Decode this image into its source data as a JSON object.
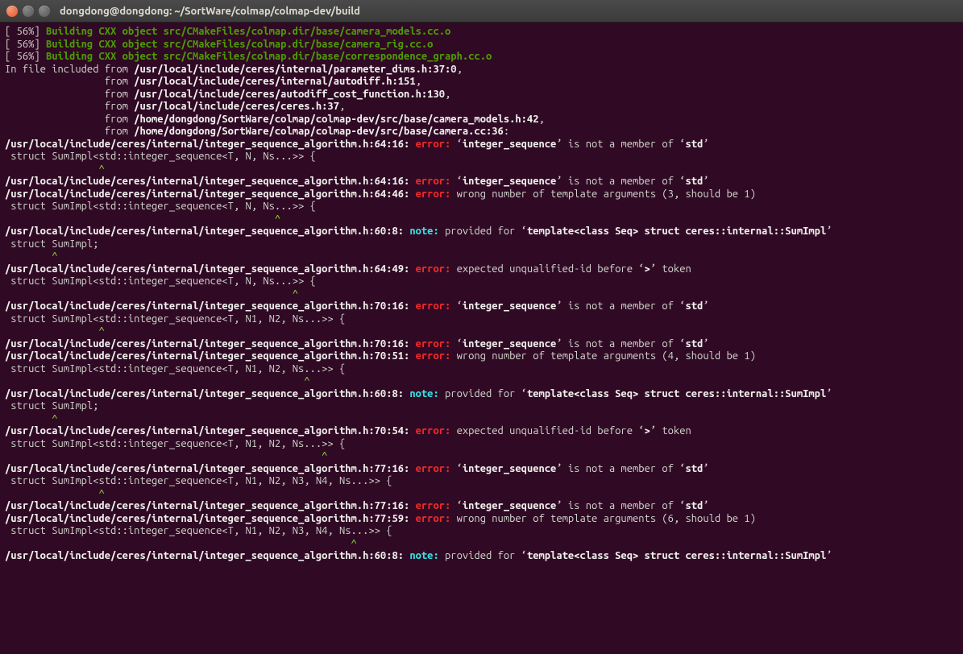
{
  "window": {
    "title": "dongdong@dongdong: ~/SortWare/colmap/colmap-dev/build"
  },
  "lines": [
    [
      {
        "cls": "w",
        "t": "[ 56%] "
      },
      {
        "cls": "gb",
        "t": "Building CXX object src/CMakeFiles/colmap.dir/base/camera_models.cc.o"
      }
    ],
    [
      {
        "cls": "w",
        "t": "[ 56%] "
      },
      {
        "cls": "gb",
        "t": "Building CXX object src/CMakeFiles/colmap.dir/base/camera_rig.cc.o"
      }
    ],
    [
      {
        "cls": "w",
        "t": "[ 56%] "
      },
      {
        "cls": "gb",
        "t": "Building CXX object src/CMakeFiles/colmap.dir/base/correspondence_graph.cc.o"
      }
    ],
    [
      {
        "cls": "w",
        "t": "In file included from "
      },
      {
        "cls": "b",
        "t": "/usr/local/include/ceres/internal/parameter_dims.h:37:0"
      },
      {
        "cls": "w",
        "t": ","
      }
    ],
    [
      {
        "cls": "w",
        "t": "                 from "
      },
      {
        "cls": "b",
        "t": "/usr/local/include/ceres/internal/autodiff.h:151"
      },
      {
        "cls": "w",
        "t": ","
      }
    ],
    [
      {
        "cls": "w",
        "t": "                 from "
      },
      {
        "cls": "b",
        "t": "/usr/local/include/ceres/autodiff_cost_function.h:130"
      },
      {
        "cls": "w",
        "t": ","
      }
    ],
    [
      {
        "cls": "w",
        "t": "                 from "
      },
      {
        "cls": "b",
        "t": "/usr/local/include/ceres/ceres.h:37"
      },
      {
        "cls": "w",
        "t": ","
      }
    ],
    [
      {
        "cls": "w",
        "t": "                 from "
      },
      {
        "cls": "b",
        "t": "/home/dongdong/SortWare/colmap/colmap-dev/src/base/camera_models.h:42"
      },
      {
        "cls": "w",
        "t": ","
      }
    ],
    [
      {
        "cls": "w",
        "t": "                 from "
      },
      {
        "cls": "b",
        "t": "/home/dongdong/SortWare/colmap/colmap-dev/src/base/camera.cc:36"
      },
      {
        "cls": "w",
        "t": ":"
      }
    ],
    [
      {
        "cls": "b",
        "t": "/usr/local/include/ceres/internal/integer_sequence_algorithm.h:64:16:"
      },
      {
        "cls": "w",
        "t": " "
      },
      {
        "cls": "r",
        "t": "error:"
      },
      {
        "cls": "w",
        "t": " ‘"
      },
      {
        "cls": "b",
        "t": "integer_sequence"
      },
      {
        "cls": "w",
        "t": "’ is not a member of ‘"
      },
      {
        "cls": "b",
        "t": "std"
      },
      {
        "cls": "w",
        "t": "’"
      }
    ],
    [
      {
        "cls": "w",
        "t": " struct SumImpl<std::integer_sequence<T, N, Ns...>> {"
      }
    ],
    [
      {
        "cls": "g",
        "t": "                ^"
      }
    ],
    [
      {
        "cls": "b",
        "t": "/usr/local/include/ceres/internal/integer_sequence_algorithm.h:64:16:"
      },
      {
        "cls": "w",
        "t": " "
      },
      {
        "cls": "r",
        "t": "error:"
      },
      {
        "cls": "w",
        "t": " ‘"
      },
      {
        "cls": "b",
        "t": "integer_sequence"
      },
      {
        "cls": "w",
        "t": "’ is not a member of ‘"
      },
      {
        "cls": "b",
        "t": "std"
      },
      {
        "cls": "w",
        "t": "’"
      }
    ],
    [
      {
        "cls": "b",
        "t": "/usr/local/include/ceres/internal/integer_sequence_algorithm.h:64:46:"
      },
      {
        "cls": "w",
        "t": " "
      },
      {
        "cls": "r",
        "t": "error:"
      },
      {
        "cls": "w",
        "t": " wrong number of template arguments (3, should be 1)"
      }
    ],
    [
      {
        "cls": "w",
        "t": " struct SumImpl<std::integer_sequence<T, N, Ns...>> {"
      }
    ],
    [
      {
        "cls": "g",
        "t": "                                              ^"
      }
    ],
    [
      {
        "cls": "b",
        "t": "/usr/local/include/ceres/internal/integer_sequence_algorithm.h:60:8:"
      },
      {
        "cls": "w",
        "t": " "
      },
      {
        "cls": "cy",
        "t": "note:"
      },
      {
        "cls": "w",
        "t": " provided for ‘"
      },
      {
        "cls": "b",
        "t": "template<class Seq> struct ceres::internal::SumImpl"
      },
      {
        "cls": "w",
        "t": "’"
      }
    ],
    [
      {
        "cls": "w",
        "t": " struct SumImpl;"
      }
    ],
    [
      {
        "cls": "g",
        "t": "        ^"
      }
    ],
    [
      {
        "cls": "b",
        "t": "/usr/local/include/ceres/internal/integer_sequence_algorithm.h:64:49:"
      },
      {
        "cls": "w",
        "t": " "
      },
      {
        "cls": "r",
        "t": "error:"
      },
      {
        "cls": "w",
        "t": " expected unqualified-id before ‘"
      },
      {
        "cls": "b",
        "t": ">"
      },
      {
        "cls": "w",
        "t": "’ token"
      }
    ],
    [
      {
        "cls": "w",
        "t": " struct SumImpl<std::integer_sequence<T, N, Ns...>> {"
      }
    ],
    [
      {
        "cls": "g",
        "t": "                                                 ^"
      }
    ],
    [
      {
        "cls": "b",
        "t": "/usr/local/include/ceres/internal/integer_sequence_algorithm.h:70:16:"
      },
      {
        "cls": "w",
        "t": " "
      },
      {
        "cls": "r",
        "t": "error:"
      },
      {
        "cls": "w",
        "t": " ‘"
      },
      {
        "cls": "b",
        "t": "integer_sequence"
      },
      {
        "cls": "w",
        "t": "’ is not a member of ‘"
      },
      {
        "cls": "b",
        "t": "std"
      },
      {
        "cls": "w",
        "t": "’"
      }
    ],
    [
      {
        "cls": "w",
        "t": " struct SumImpl<std::integer_sequence<T, N1, N2, Ns...>> {"
      }
    ],
    [
      {
        "cls": "g",
        "t": "                ^"
      }
    ],
    [
      {
        "cls": "b",
        "t": "/usr/local/include/ceres/internal/integer_sequence_algorithm.h:70:16:"
      },
      {
        "cls": "w",
        "t": " "
      },
      {
        "cls": "r",
        "t": "error:"
      },
      {
        "cls": "w",
        "t": " ‘"
      },
      {
        "cls": "b",
        "t": "integer_sequence"
      },
      {
        "cls": "w",
        "t": "’ is not a member of ‘"
      },
      {
        "cls": "b",
        "t": "std"
      },
      {
        "cls": "w",
        "t": "’"
      }
    ],
    [
      {
        "cls": "b",
        "t": "/usr/local/include/ceres/internal/integer_sequence_algorithm.h:70:51:"
      },
      {
        "cls": "w",
        "t": " "
      },
      {
        "cls": "r",
        "t": "error:"
      },
      {
        "cls": "w",
        "t": " wrong number of template arguments (4, should be 1)"
      }
    ],
    [
      {
        "cls": "w",
        "t": " struct SumImpl<std::integer_sequence<T, N1, N2, Ns...>> {"
      }
    ],
    [
      {
        "cls": "g",
        "t": "                                                   ^"
      }
    ],
    [
      {
        "cls": "b",
        "t": "/usr/local/include/ceres/internal/integer_sequence_algorithm.h:60:8:"
      },
      {
        "cls": "w",
        "t": " "
      },
      {
        "cls": "cy",
        "t": "note:"
      },
      {
        "cls": "w",
        "t": " provided for ‘"
      },
      {
        "cls": "b",
        "t": "template<class Seq> struct ceres::internal::SumImpl"
      },
      {
        "cls": "w",
        "t": "’"
      }
    ],
    [
      {
        "cls": "w",
        "t": " struct SumImpl;"
      }
    ],
    [
      {
        "cls": "g",
        "t": "        ^"
      }
    ],
    [
      {
        "cls": "b",
        "t": "/usr/local/include/ceres/internal/integer_sequence_algorithm.h:70:54:"
      },
      {
        "cls": "w",
        "t": " "
      },
      {
        "cls": "r",
        "t": "error:"
      },
      {
        "cls": "w",
        "t": " expected unqualified-id before ‘"
      },
      {
        "cls": "b",
        "t": ">"
      },
      {
        "cls": "w",
        "t": "’ token"
      }
    ],
    [
      {
        "cls": "w",
        "t": " struct SumImpl<std::integer_sequence<T, N1, N2, Ns...>> {"
      }
    ],
    [
      {
        "cls": "g",
        "t": "                                                      ^"
      }
    ],
    [
      {
        "cls": "b",
        "t": "/usr/local/include/ceres/internal/integer_sequence_algorithm.h:77:16:"
      },
      {
        "cls": "w",
        "t": " "
      },
      {
        "cls": "r",
        "t": "error:"
      },
      {
        "cls": "w",
        "t": " ‘"
      },
      {
        "cls": "b",
        "t": "integer_sequence"
      },
      {
        "cls": "w",
        "t": "’ is not a member of ‘"
      },
      {
        "cls": "b",
        "t": "std"
      },
      {
        "cls": "w",
        "t": "’"
      }
    ],
    [
      {
        "cls": "w",
        "t": " struct SumImpl<std::integer_sequence<T, N1, N2, N3, N4, Ns...>> {"
      }
    ],
    [
      {
        "cls": "g",
        "t": "                ^"
      }
    ],
    [
      {
        "cls": "b",
        "t": "/usr/local/include/ceres/internal/integer_sequence_algorithm.h:77:16:"
      },
      {
        "cls": "w",
        "t": " "
      },
      {
        "cls": "r",
        "t": "error:"
      },
      {
        "cls": "w",
        "t": " ‘"
      },
      {
        "cls": "b",
        "t": "integer_sequence"
      },
      {
        "cls": "w",
        "t": "’ is not a member of ‘"
      },
      {
        "cls": "b",
        "t": "std"
      },
      {
        "cls": "w",
        "t": "’"
      }
    ],
    [
      {
        "cls": "b",
        "t": "/usr/local/include/ceres/internal/integer_sequence_algorithm.h:77:59:"
      },
      {
        "cls": "w",
        "t": " "
      },
      {
        "cls": "r",
        "t": "error:"
      },
      {
        "cls": "w",
        "t": " wrong number of template arguments (6, should be 1)"
      }
    ],
    [
      {
        "cls": "w",
        "t": " struct SumImpl<std::integer_sequence<T, N1, N2, N3, N4, Ns...>> {"
      }
    ],
    [
      {
        "cls": "g",
        "t": "                                                           ^"
      }
    ],
    [
      {
        "cls": "b",
        "t": "/usr/local/include/ceres/internal/integer_sequence_algorithm.h:60:8:"
      },
      {
        "cls": "w",
        "t": " "
      },
      {
        "cls": "cy",
        "t": "note:"
      },
      {
        "cls": "w",
        "t": " provided for ‘"
      },
      {
        "cls": "b",
        "t": "template<class Seq> struct ceres::internal::SumImpl"
      },
      {
        "cls": "w",
        "t": "’"
      }
    ]
  ]
}
